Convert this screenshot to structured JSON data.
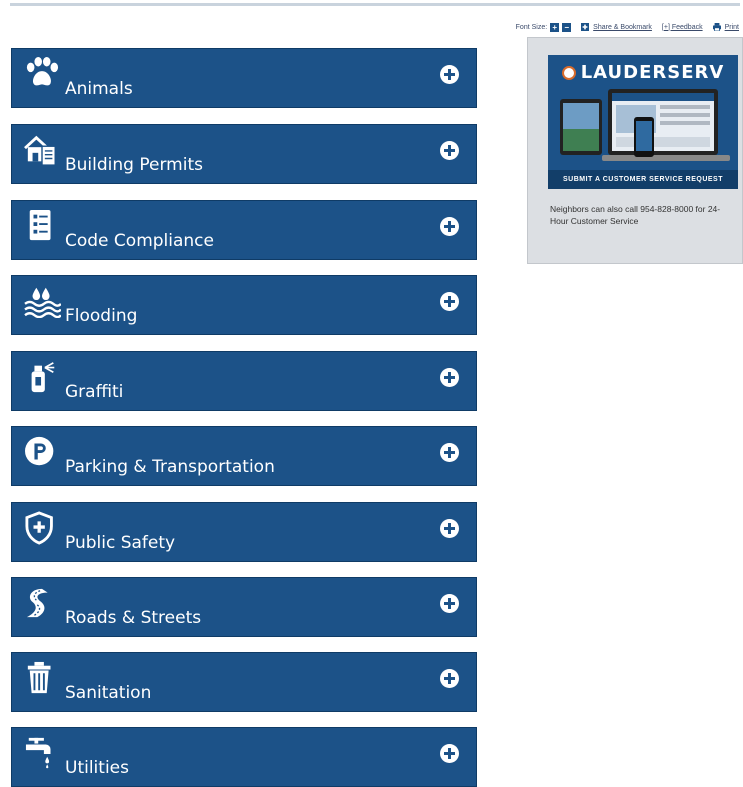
{
  "toolbar": {
    "font_size_label": "Font Size:",
    "increase_label": "+",
    "decrease_label": "−",
    "share_label": "Share & Bookmark",
    "feedback_label": "[+] Feedback",
    "print_label": "Print"
  },
  "accordion": [
    {
      "label": "Animals",
      "icon": "paw-icon"
    },
    {
      "label": "Building Permits",
      "icon": "house-document-icon"
    },
    {
      "label": "Code Compliance",
      "icon": "checklist-icon"
    },
    {
      "label": "Flooding",
      "icon": "flood-water-icon"
    },
    {
      "label": "Graffiti",
      "icon": "spray-can-icon"
    },
    {
      "label": "Parking & Transportation",
      "icon": "parking-icon"
    },
    {
      "label": "Public Safety",
      "icon": "shield-icon"
    },
    {
      "label": "Roads & Streets",
      "icon": "road-icon"
    },
    {
      "label": "Sanitation",
      "icon": "trash-can-icon"
    },
    {
      "label": "Utilities",
      "icon": "faucet-icon"
    }
  ],
  "sidebar": {
    "promo_title": "LAUDERSERV",
    "promo_cta": "SUBMIT A CUSTOMER SERVICE REQUEST",
    "note": "Neighbors can also call 954-828-8000 for 24-Hour Customer Service"
  },
  "colors": {
    "accordion_bg": "#1c5288",
    "sidebar_bg": "#dcdfe3"
  }
}
